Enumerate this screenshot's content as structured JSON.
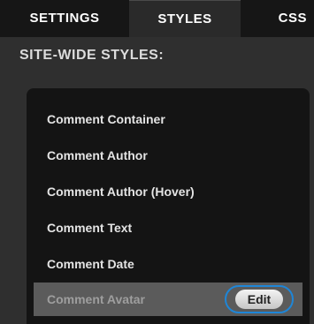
{
  "tabs": [
    {
      "label": "SETTINGS"
    },
    {
      "label": "STYLES"
    },
    {
      "label": "CSS"
    }
  ],
  "section_title": "SITE-WIDE STYLES:",
  "style_items": [
    {
      "label": "Comment Container"
    },
    {
      "label": "Comment Author"
    },
    {
      "label": "Comment Author (Hover)"
    },
    {
      "label": "Comment Text"
    },
    {
      "label": "Comment Date"
    },
    {
      "label": "Comment Avatar"
    }
  ],
  "edit_label": "Edit",
  "colors": {
    "highlight_ring": "#1e86d8",
    "selected_row": "#5b5b5b"
  }
}
